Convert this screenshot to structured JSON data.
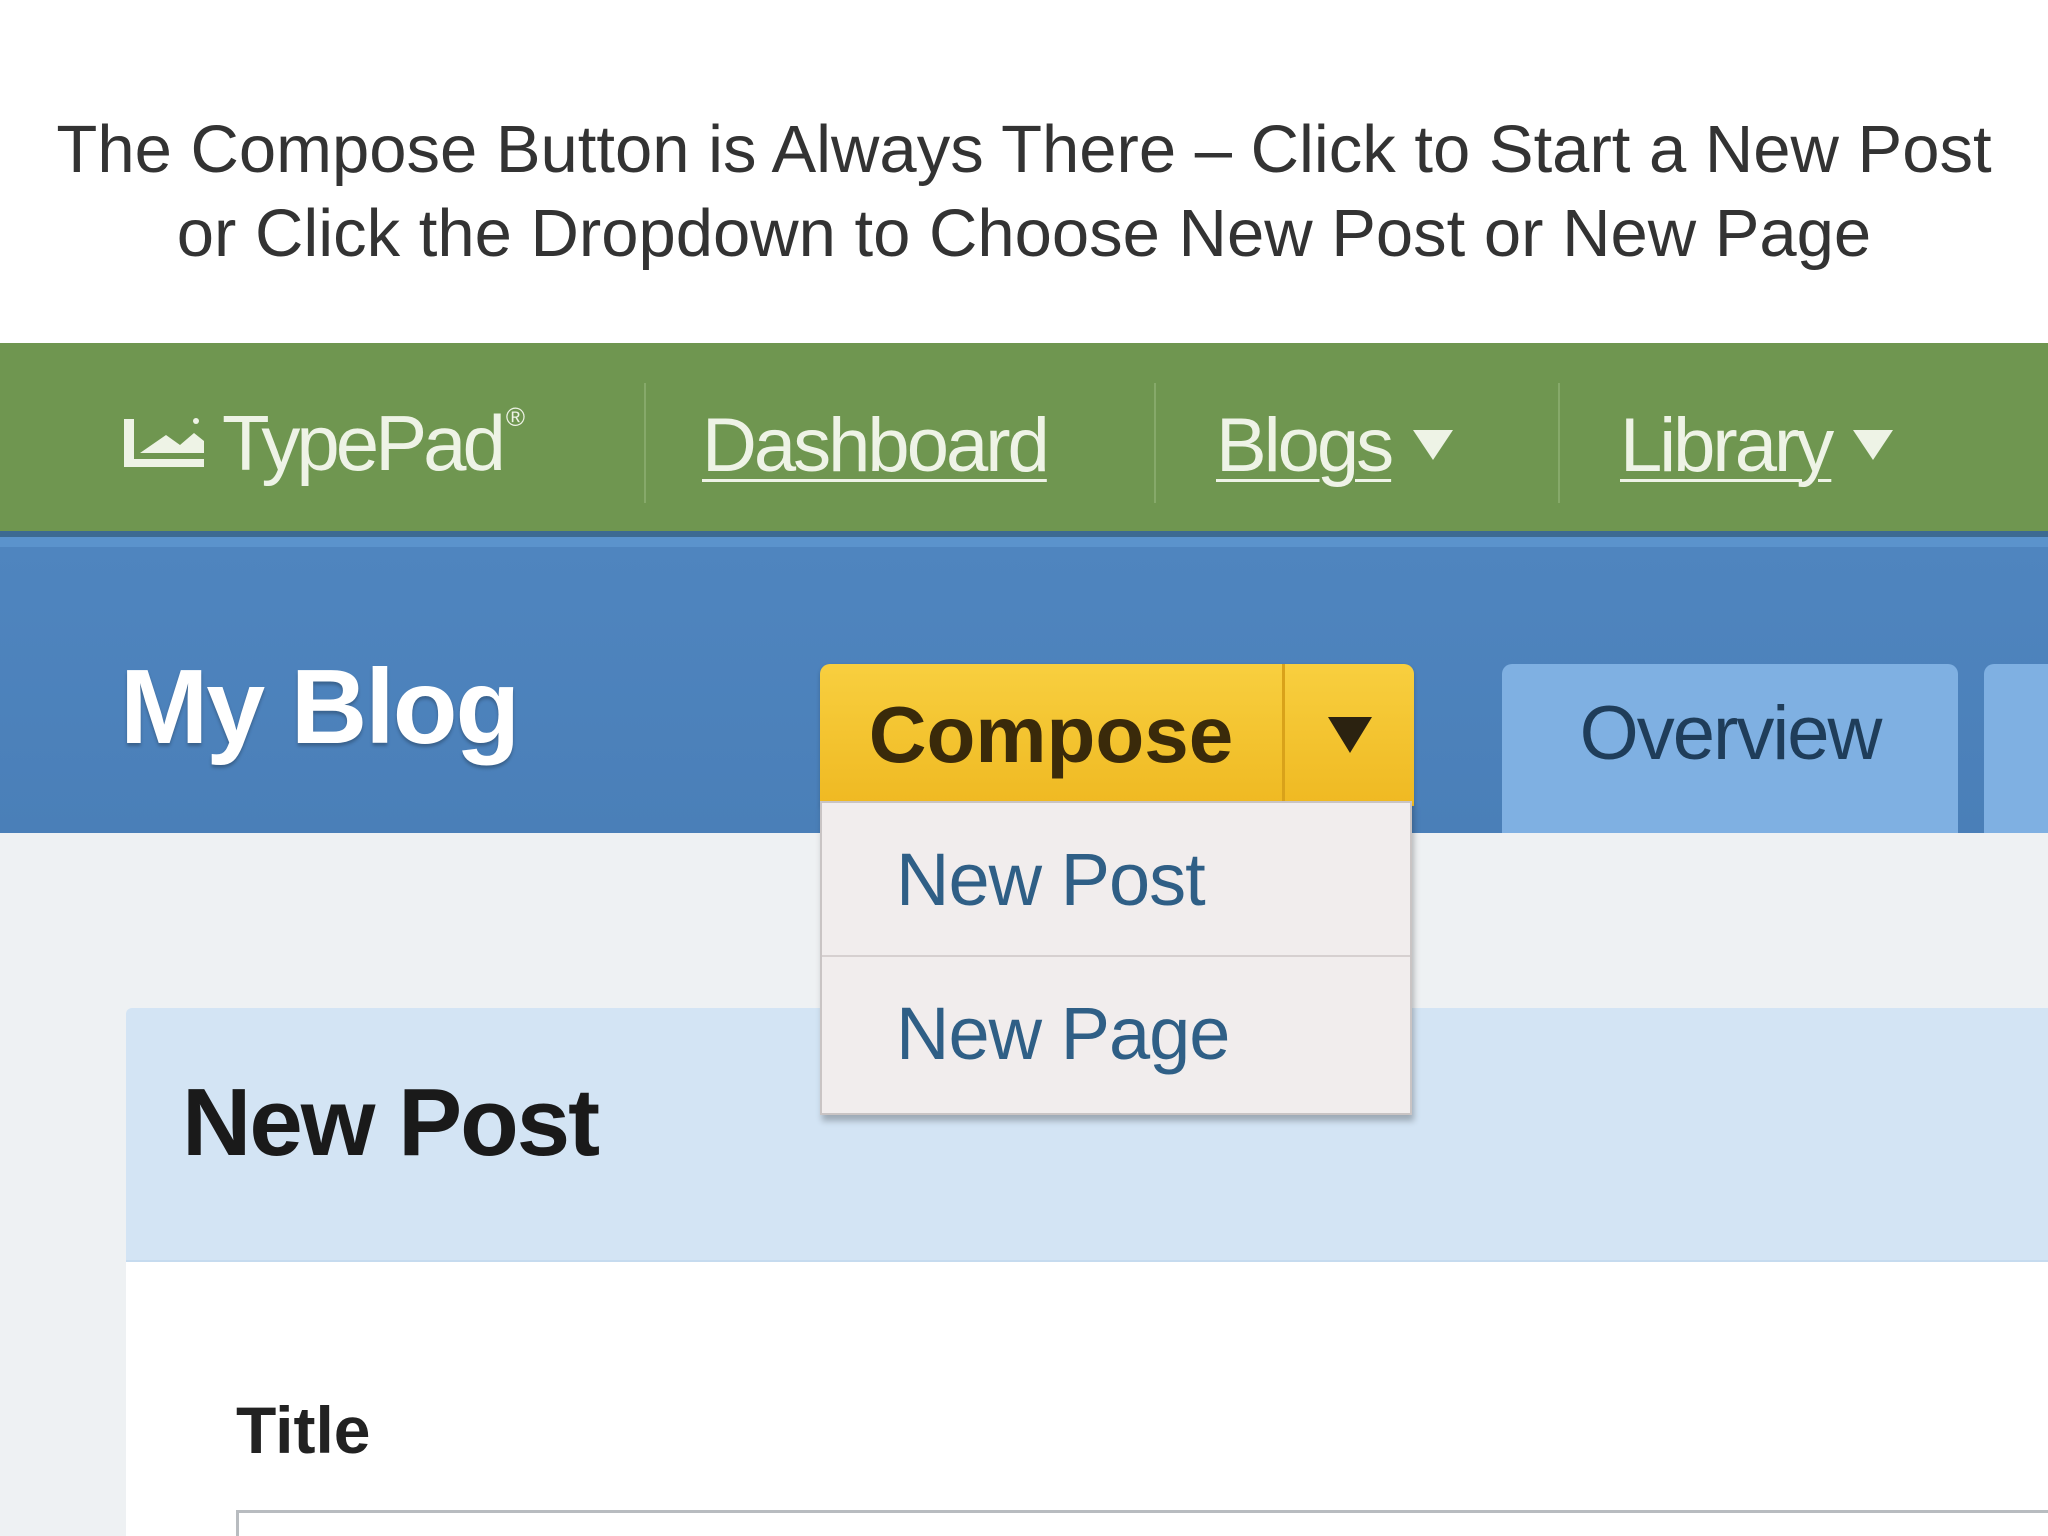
{
  "caption": {
    "line1": "The Compose Button is Always There – Click to Start a New Post",
    "line2": "or Click the Dropdown to Choose New Post or New Page"
  },
  "topnav": {
    "logo_text": "TypePad",
    "logo_reg": "®",
    "links": [
      {
        "label": "Dashboard",
        "has_caret": false
      },
      {
        "label": "Blogs",
        "has_caret": true
      },
      {
        "label": "Library",
        "has_caret": true
      }
    ]
  },
  "blogbar": {
    "blog_title": "My Blog",
    "compose_label": "Compose",
    "tabs": [
      {
        "label": "Overview"
      }
    ]
  },
  "dropdown": {
    "items": [
      {
        "label": "New Post"
      },
      {
        "label": "New Page"
      }
    ]
  },
  "content": {
    "panel_title": "New Post",
    "title_field_label": "Title",
    "title_field_value": ""
  },
  "colors": {
    "nav_green": "#6f9650",
    "bar_blue": "#4f85bf",
    "compose_yellow": "#f8cf3f",
    "tab_blue": "#7fb0e2",
    "link_blue": "#2f5f86"
  }
}
